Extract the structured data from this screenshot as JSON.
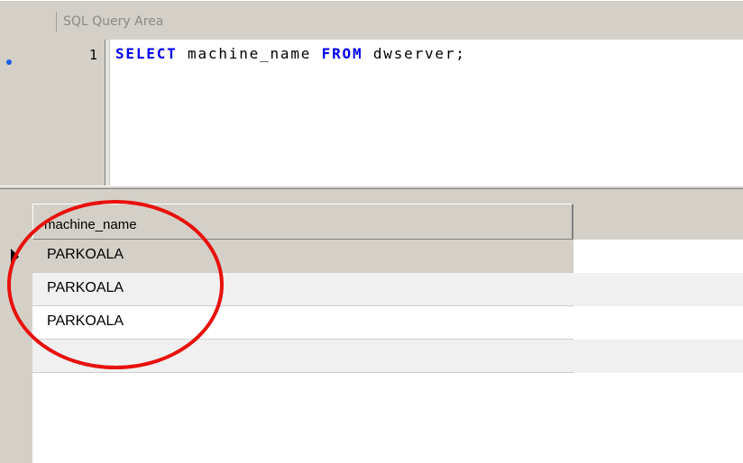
{
  "query_area": {
    "title": "SQL Query Area"
  },
  "editor": {
    "line_number": "1",
    "tokens": {
      "kw_select": "SELECT",
      "ident": " machine_name ",
      "kw_from": "FROM",
      "tail": " dwserver;"
    }
  },
  "results": {
    "columns": [
      "machine_name"
    ],
    "rows": [
      {
        "machine_name": "PARKOALA"
      },
      {
        "machine_name": "PARKOALA"
      },
      {
        "machine_name": "PARKOALA"
      }
    ],
    "current_row_index": 0
  },
  "colors": {
    "keyword": "#0000f0",
    "grid_face": "#d4d0c8",
    "selected_row": "#d4d0c8",
    "alt_row": "#f0f0f0",
    "annotation": "#e8100c"
  },
  "icons": {
    "current_line_marker": "breakpoint-dot-icon",
    "row_indicator": "current-row-arrow-icon"
  }
}
